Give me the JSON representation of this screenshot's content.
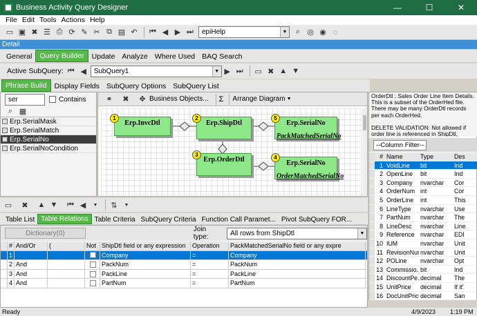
{
  "window": {
    "title": "Business Activity Query Designer",
    "minimize": "—",
    "maximize": "☐",
    "close": "✕"
  },
  "menu": [
    "File",
    "Edit",
    "Tools",
    "Actions",
    "Help"
  ],
  "toolbar": {
    "help_combo": "epiHelp"
  },
  "detail_label": "Detail",
  "main_tabs": [
    "General",
    "Query Builder",
    "Update",
    "Analyze",
    "Where Used",
    "BAQ Search"
  ],
  "active_subquery": {
    "label": "Active SubQuery:",
    "value": "SubQuery1"
  },
  "sub_tabs": [
    "Phrase Build",
    "Display Fields",
    "SubQuery Options",
    "SubQuery List"
  ],
  "table_search": {
    "value": "ser",
    "contains_label": "Contains"
  },
  "table_list": [
    "Erp.SerialMask",
    "Erp.SerialMatch",
    "Erp.SerialNo",
    "Erp.SerialNoCondition"
  ],
  "diagram_toolbar": {
    "business_objects": "Business Objects...",
    "sum": "Σ",
    "arrange": "Arrange Diagram"
  },
  "diagram_nodes": [
    {
      "num": "1",
      "name": "Erp.InvcDtl",
      "field": ""
    },
    {
      "num": "2",
      "name": "Erp.ShipDtl",
      "field": ""
    },
    {
      "num": "3",
      "name": "Erp.OrderDtl",
      "field": ""
    },
    {
      "num": "5",
      "name": "Erp.SerialNo",
      "field": "PackMatchedSerialNo"
    },
    {
      "num": "4",
      "name": "Erp.SerialNo",
      "field": "OrderMatchedSerialNo"
    }
  ],
  "description": "OrderDtl : Sales Order Line Item Details. This is a subset of the OrderHed file. There may be many OrderDtl records per each OrderHed.\n\nDELETE VALIDATION: Not allowed if order line is referenced in ShipDtl, InvcDtl",
  "column_filter": "--Column Filter--",
  "column_headers": [
    "#",
    "Name",
    "Type",
    "Des"
  ],
  "columns": [
    {
      "n": "1",
      "name": "VoidLine",
      "type": "bit",
      "desc": "Ind"
    },
    {
      "n": "2",
      "name": "OpenLine",
      "type": "bit",
      "desc": "Ind"
    },
    {
      "n": "3",
      "name": "Company",
      "type": "nvarchar",
      "desc": "Cor"
    },
    {
      "n": "4",
      "name": "OrderNum",
      "type": "int",
      "desc": "Cor"
    },
    {
      "n": "5",
      "name": "OrderLine",
      "type": "int",
      "desc": "This"
    },
    {
      "n": "6",
      "name": "LineType",
      "type": "nvarchar",
      "desc": "Use"
    },
    {
      "n": "7",
      "name": "PartNum",
      "type": "nvarchar",
      "desc": "The"
    },
    {
      "n": "8",
      "name": "LineDesc",
      "type": "nvarchar",
      "desc": "Line"
    },
    {
      "n": "9",
      "name": "Reference",
      "type": "nvarchar",
      "desc": "EDI"
    },
    {
      "n": "10",
      "name": "IUM",
      "type": "nvarchar",
      "desc": "Unit"
    },
    {
      "n": "11",
      "name": "RevisionNum",
      "type": "nvarchar",
      "desc": "Unit"
    },
    {
      "n": "12",
      "name": "POLine",
      "type": "nvarchar",
      "desc": "Opt"
    },
    {
      "n": "13",
      "name": "Commissio...",
      "type": "bit",
      "desc": "Ind"
    },
    {
      "n": "14",
      "name": "DiscountPe...",
      "type": "decimal",
      "desc": "The"
    },
    {
      "n": "15",
      "name": "UnitPrice",
      "type": "decimal",
      "desc": "If it'"
    },
    {
      "n": "16",
      "name": "DocUnitPrice",
      "type": "decimal",
      "desc": "San"
    }
  ],
  "bottom_tabs": [
    "Table List",
    "Table Relations",
    "Table Criteria",
    "SubQuery Criteria",
    "Function Call Paramet...",
    "Pivot SubQuery FOR..."
  ],
  "relations": {
    "dictionary_label": "Dictionary(0)",
    "join_label": "Join type:",
    "join_value": "All rows from ShipDtl",
    "headers": [
      "#",
      "And/Or",
      "(",
      "Not",
      "ShipDtl field or any expression",
      "Operation",
      "PackMatchedSerialNo field or any expre"
    ],
    "rows": [
      {
        "n": "1",
        "andor": "",
        "left": "Company",
        "op": "=",
        "right": "Company"
      },
      {
        "n": "2",
        "andor": "And",
        "left": "PackNum",
        "op": "=",
        "right": "PackNum"
      },
      {
        "n": "3",
        "andor": "And",
        "left": "PackLine",
        "op": "=",
        "right": "PackLine"
      },
      {
        "n": "4",
        "andor": "And",
        "left": "PartNum",
        "op": "=",
        "right": "PartNum"
      }
    ]
  },
  "status": {
    "text": "Ready",
    "date": "4/9/2023",
    "time": "1:19 PM"
  }
}
